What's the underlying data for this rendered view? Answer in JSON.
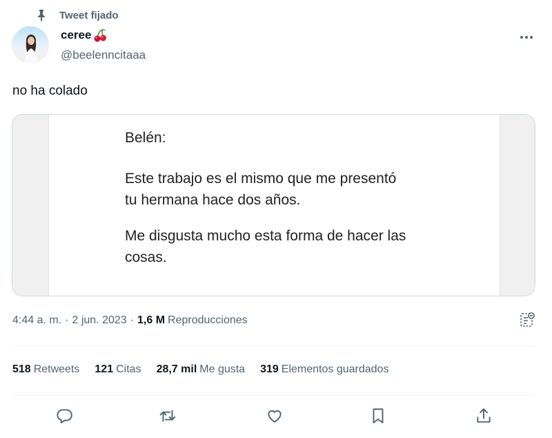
{
  "pinned": {
    "label": "Tweet fijado"
  },
  "author": {
    "name": "ceree",
    "handle": "@beelenncitaaa",
    "emoji": "cherries"
  },
  "tweet": {
    "text": "no ha colado"
  },
  "media": {
    "greeting": "Belén:",
    "paragraph1_line1": "Este trabajo es el mismo que me presentó",
    "paragraph1_line2": "tu hermana hace dos años.",
    "paragraph2_line1": "Me disgusta mucho esta forma de hacer las",
    "paragraph2_line2": "cosas."
  },
  "meta": {
    "time": "4:44 a. m.",
    "date": "2 jun. 2023",
    "views_count": "1,6 M",
    "views_label": "Reproducciones"
  },
  "stats": {
    "retweets_count": "518",
    "retweets_label": "Retweets",
    "quotes_count": "121",
    "quotes_label": "Citas",
    "likes_count": "28,7 mil",
    "likes_label": "Me gusta",
    "bookmarks_count": "319",
    "bookmarks_label": "Elementos guardados"
  },
  "icons": [
    "pin-icon",
    "cherry-icon",
    "more-icon",
    "analytics-icon",
    "reply-icon",
    "retweet-icon",
    "like-icon",
    "bookmark-icon",
    "share-icon"
  ],
  "colors": {
    "text": "#0f1419",
    "secondary": "#536471",
    "border": "#cfd9de"
  }
}
